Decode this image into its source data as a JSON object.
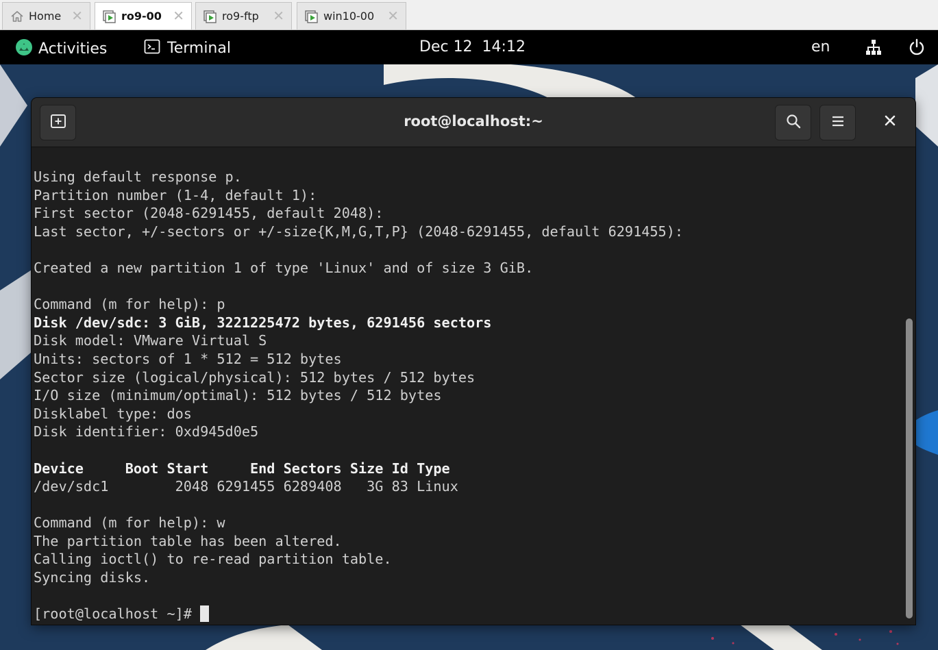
{
  "vm_tabs": [
    {
      "label": "Home",
      "icon": "home-icon",
      "active": false
    },
    {
      "label": "ro9-00",
      "icon": "vm-play-icon",
      "active": true
    },
    {
      "label": "ro9-ftp",
      "icon": "vm-play-icon",
      "active": false
    },
    {
      "label": "win10-00",
      "icon": "vm-play-icon",
      "active": false
    }
  ],
  "topbar": {
    "activities": "Activities",
    "app_name": "Terminal",
    "clock": "Dec 12  14:12",
    "language": "en",
    "icons": [
      "network-icon",
      "power-icon"
    ]
  },
  "terminal": {
    "title": "root@localhost:~",
    "lines": [
      {
        "text": "Using default response p.",
        "bold": false
      },
      {
        "text": "Partition number (1-4, default 1):",
        "bold": false
      },
      {
        "text": "First sector (2048-6291455, default 2048):",
        "bold": false
      },
      {
        "text": "Last sector, +/-sectors or +/-size{K,M,G,T,P} (2048-6291455, default 6291455):",
        "bold": false
      },
      {
        "text": "",
        "bold": false
      },
      {
        "text": "Created a new partition 1 of type 'Linux' and of size 3 GiB.",
        "bold": false
      },
      {
        "text": "",
        "bold": false
      },
      {
        "text": "Command (m for help): p",
        "bold": false
      },
      {
        "text": "Disk /dev/sdc: 3 GiB, 3221225472 bytes, 6291456 sectors",
        "bold": true
      },
      {
        "text": "Disk model: VMware Virtual S",
        "bold": false
      },
      {
        "text": "Units: sectors of 1 * 512 = 512 bytes",
        "bold": false
      },
      {
        "text": "Sector size (logical/physical): 512 bytes / 512 bytes",
        "bold": false
      },
      {
        "text": "I/O size (minimum/optimal): 512 bytes / 512 bytes",
        "bold": false
      },
      {
        "text": "Disklabel type: dos",
        "bold": false
      },
      {
        "text": "Disk identifier: 0xd945d0e5",
        "bold": false
      },
      {
        "text": "",
        "bold": false
      },
      {
        "text": "Device     Boot Start     End Sectors Size Id Type",
        "bold": true
      },
      {
        "text": "/dev/sdc1        2048 6291455 6289408   3G 83 Linux",
        "bold": false
      },
      {
        "text": "",
        "bold": false
      },
      {
        "text": "Command (m for help): w",
        "bold": false
      },
      {
        "text": "The partition table has been altered.",
        "bold": false
      },
      {
        "text": "Calling ioctl() to re-read partition table.",
        "bold": false
      },
      {
        "text": "Syncing disks.",
        "bold": false
      },
      {
        "text": "",
        "bold": false
      }
    ],
    "prompt": "[root@localhost ~]# "
  },
  "colors": {
    "wallpaper": "#1e3a5c",
    "terminal_bg": "#1e1e1e",
    "headerbar_bg": "#2b2b2b",
    "activities_logo": "#3ec487",
    "vm_play": "#3aa33a"
  }
}
